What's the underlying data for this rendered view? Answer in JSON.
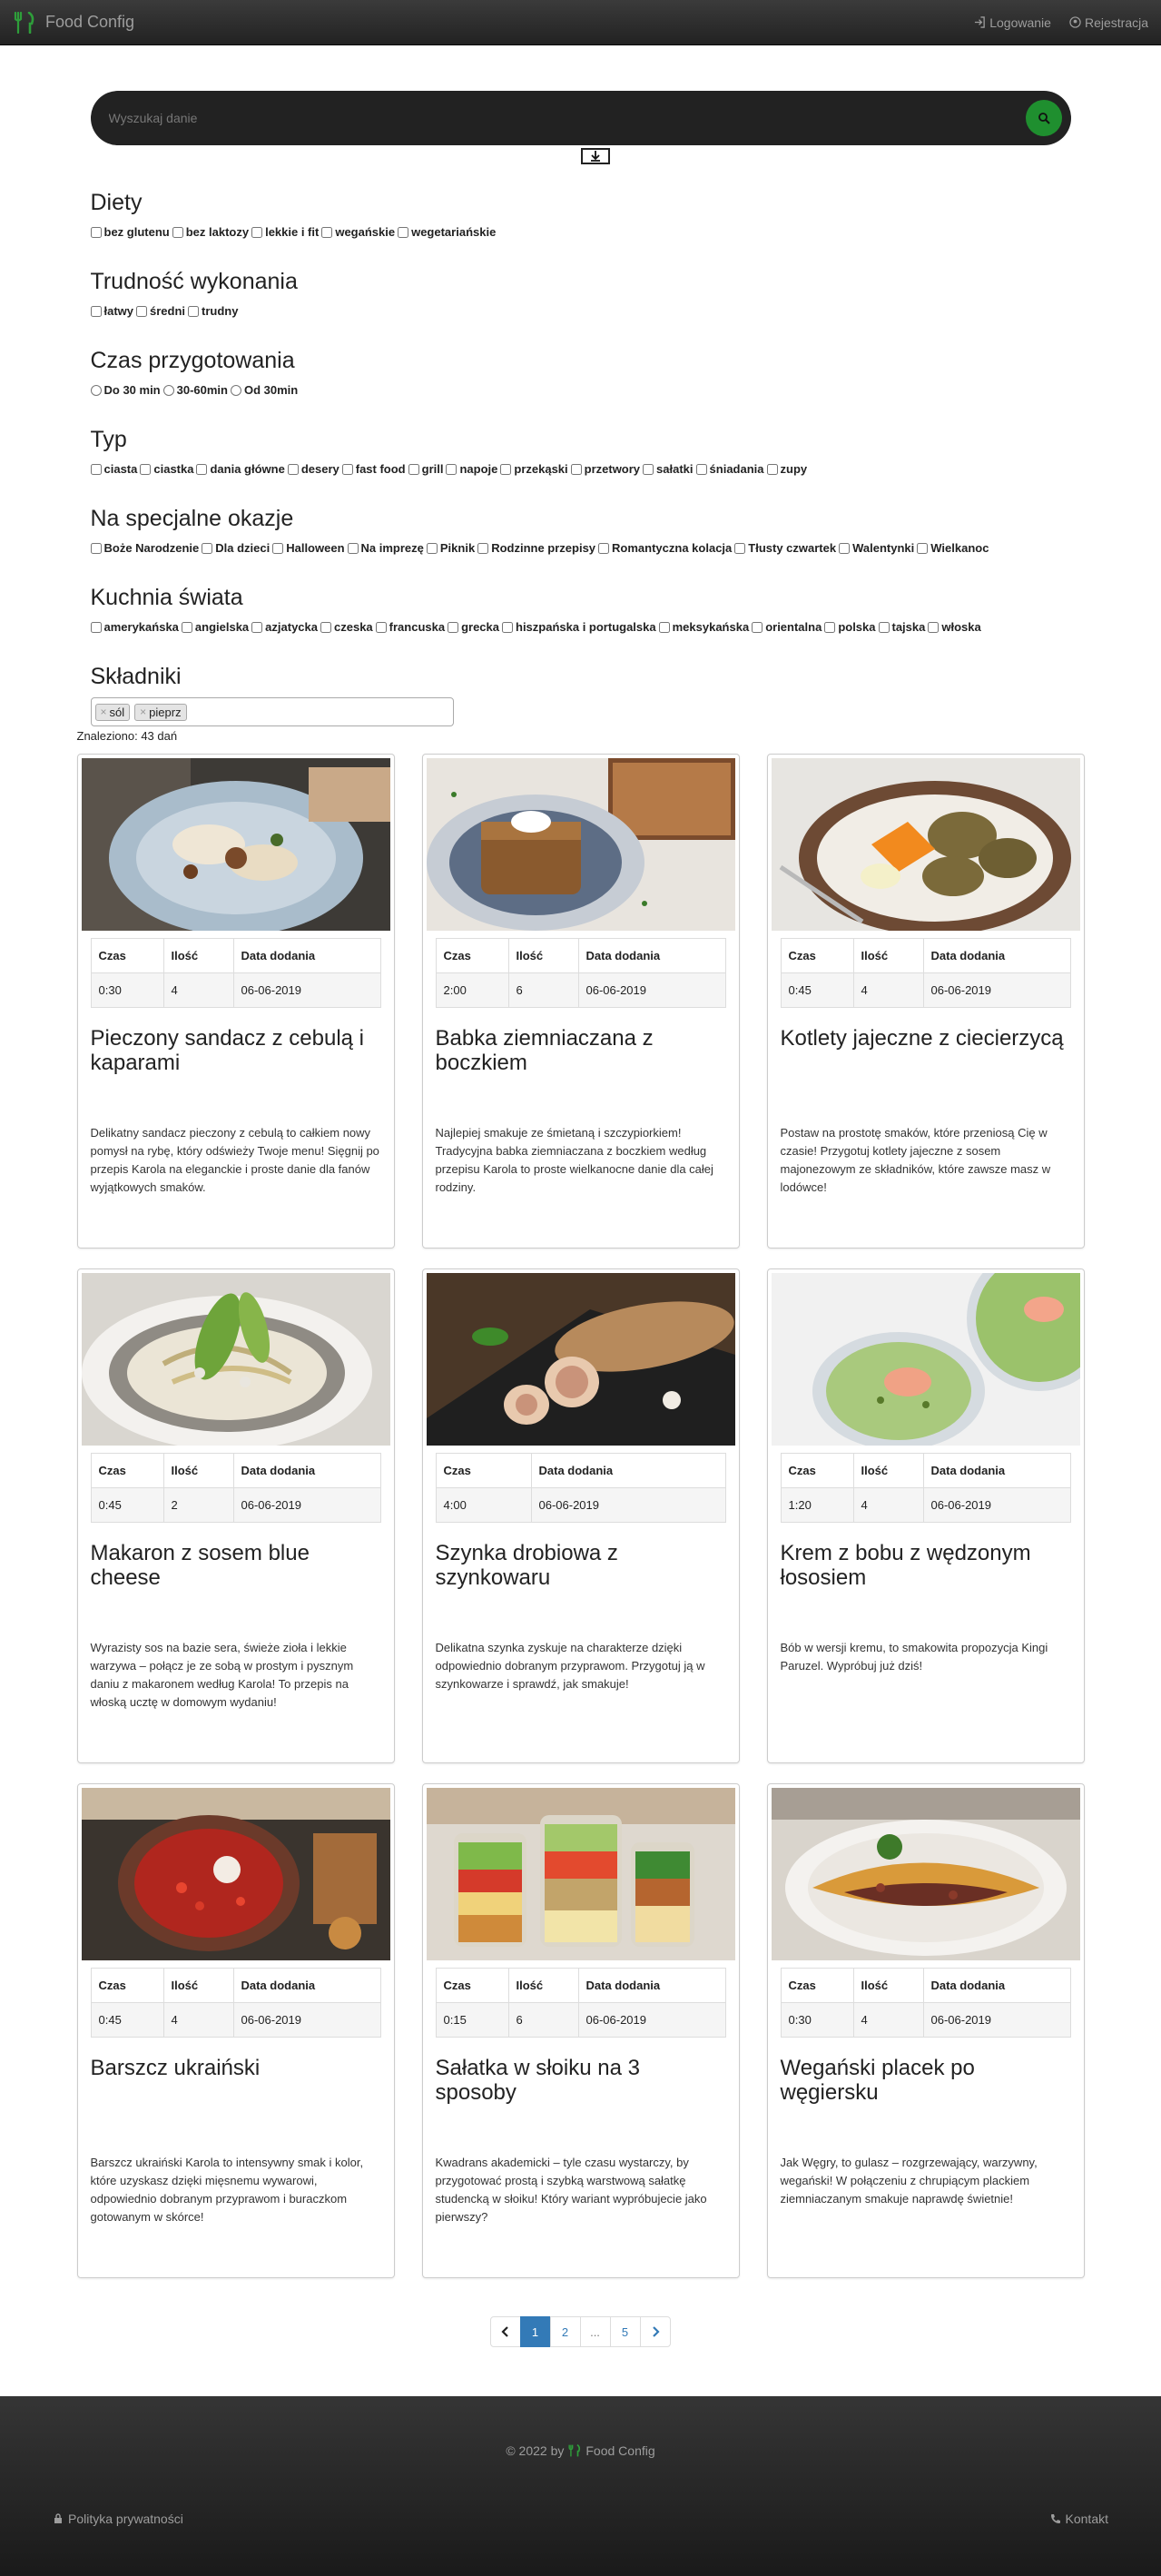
{
  "navbar": {
    "brand": "Food Config",
    "login": "Logowanie",
    "register": "Rejestracja"
  },
  "search": {
    "placeholder": "Wyszukaj danie"
  },
  "filters": [
    {
      "title": "Diety",
      "type": "checkbox",
      "options": [
        "bez glutenu",
        "bez laktozy",
        "lekkie i fit",
        "wegańskie",
        "wegetariańskie"
      ]
    },
    {
      "title": "Trudność wykonania",
      "type": "checkbox",
      "options": [
        "łatwy",
        "średni",
        "trudny"
      ]
    },
    {
      "title": "Czas przygotowania",
      "type": "radio",
      "options": [
        "Do 30 min",
        "30-60min",
        "Od 30min"
      ]
    },
    {
      "title": "Typ",
      "type": "checkbox",
      "options": [
        "ciasta",
        "ciastka",
        "dania główne",
        "desery",
        "fast food",
        "grill",
        "napoje",
        "przekąski",
        "przetwory",
        "sałatki",
        "śniadania",
        "zupy"
      ]
    },
    {
      "title": "Na specjalne okazje",
      "type": "checkbox",
      "options": [
        "Boże Narodzenie",
        "Dla dzieci",
        "Halloween",
        "Na imprezę",
        "Piknik",
        "Rodzinne przepisy",
        "Romantyczna kolacja",
        "Tłusty czwartek",
        "Walentynki",
        "Wielkanoc"
      ]
    },
    {
      "title": "Kuchnia świata",
      "type": "checkbox",
      "options": [
        "amerykańska",
        "angielska",
        "azjatycka",
        "czeska",
        "francuska",
        "grecka",
        "hiszpańska i portugalska",
        "meksykańska",
        "orientalna",
        "polska",
        "tajska",
        "włoska"
      ]
    }
  ],
  "ingredients": {
    "title": "Składniki",
    "tags": [
      "sól",
      "pieprz"
    ],
    "remove_symbol": "×"
  },
  "results": {
    "found_text": "Znaleziono: 43 dań"
  },
  "table_headers": {
    "time": "Czas",
    "qty": "Ilość",
    "date": "Data dodania"
  },
  "recipes": [
    {
      "time": "0:30",
      "qty": "4",
      "date": "06-06-2019",
      "title": "Pieczony sandacz z cebulą i kaparami",
      "description": "Delikatny sandacz pieczony z cebulą to całkiem nowy pomysł na rybę, który odświeży Twoje menu! Sięgnij po przepis Karola na eleganckie i proste danie dla fanów wyjątkowych smaków.",
      "image": "grilled-fish-plate"
    },
    {
      "time": "2:00",
      "qty": "6",
      "date": "06-06-2019",
      "title": "Babka ziemniaczana z boczkiem",
      "description": "Najlepiej smakuje ze śmietaną i szczypiorkiem! Tradycyjna babka ziemniaczana z boczkiem według przepisu Karola to proste wielkanocne danie dla całej rodziny.",
      "image": "potato-cake-plate"
    },
    {
      "time": "0:45",
      "qty": "4",
      "date": "06-06-2019",
      "title": "Kotlety jajeczne z ciecierzycą",
      "description": "Postaw na prostotę smaków, które przeniosą Cię w czasie! Przygotuj kotlety jajeczne z sosem majonezowym ze składników, które zawsze masz w lodówce!",
      "image": "cutlets-plate"
    },
    {
      "time": "0:45",
      "qty": "2",
      "date": "06-06-2019",
      "title": "Makaron z sosem blue cheese",
      "description": "Wyrazisty sos na bazie sera, świeże zioła i lekkie warzywa – połącz je ze sobą w prostym i pysznym daniu z makaronem według Karola! To przepis na włoską ucztę w domowym wydaniu!",
      "image": "pasta-bowl"
    },
    {
      "time": "4:00",
      "date": "06-06-2019",
      "title": "Szynka drobiowa z szynkowaru",
      "description": "Delikatna szynka zyskuje na charakterze dzięki odpowiednio dobranym przyprawom. Przygotuj ją w szynkowarze i sprawdź, jak smakuje!",
      "image": "ham-board"
    },
    {
      "time": "1:20",
      "qty": "4",
      "date": "06-06-2019",
      "title": "Krem z bobu z wędzonym łososiem",
      "description": "Bób w wersji kremu, to smakowita propozycja Kingi Paruzel. Wypróbuj już dziś!",
      "image": "green-soup-bowl"
    },
    {
      "time": "0:45",
      "qty": "4",
      "date": "06-06-2019",
      "title": "Barszcz ukraiński",
      "description": "Barszcz ukraiński Karola to intensywny smak i kolor, które uzyskasz dzięki mięsnemu wywarowi, odpowiednio dobranym przyprawom i buraczkom gotowanym w skórce!",
      "image": "borscht-bowl"
    },
    {
      "time": "0:15",
      "qty": "6",
      "date": "06-06-2019",
      "title": "Sałatka w słoiku na 3 sposoby",
      "description": "Kwadrans akademicki – tyle czasu wystarczy, by przygotować prostą i szybką warstwową sałatkę studencką w słoiku! Który wariant wypróbujecie jako pierwszy?",
      "image": "salad-jars"
    },
    {
      "time": "0:30",
      "qty": "4",
      "date": "06-06-2019",
      "title": "Wegański placek po węgiersku",
      "description": "Jak Węgry, to gulasz – rozgrzewający, warzywny, wegański! W połączeniu z chrupiącym plackiem ziemniaczanym smakuje naprawdę świetnie!",
      "image": "potato-pancake-plate"
    }
  ],
  "pagination": {
    "pages": [
      "1",
      "2",
      "...",
      "5"
    ],
    "active": "1"
  },
  "footer": {
    "copyright_prefix": "© 2022 by",
    "brand": "Food Config",
    "privacy": "Polityka prywatności",
    "contact": "Kontakt"
  },
  "colors": {
    "navbar": "#222222",
    "accent_green": "#1f8f2f",
    "link_blue": "#337ab7"
  }
}
